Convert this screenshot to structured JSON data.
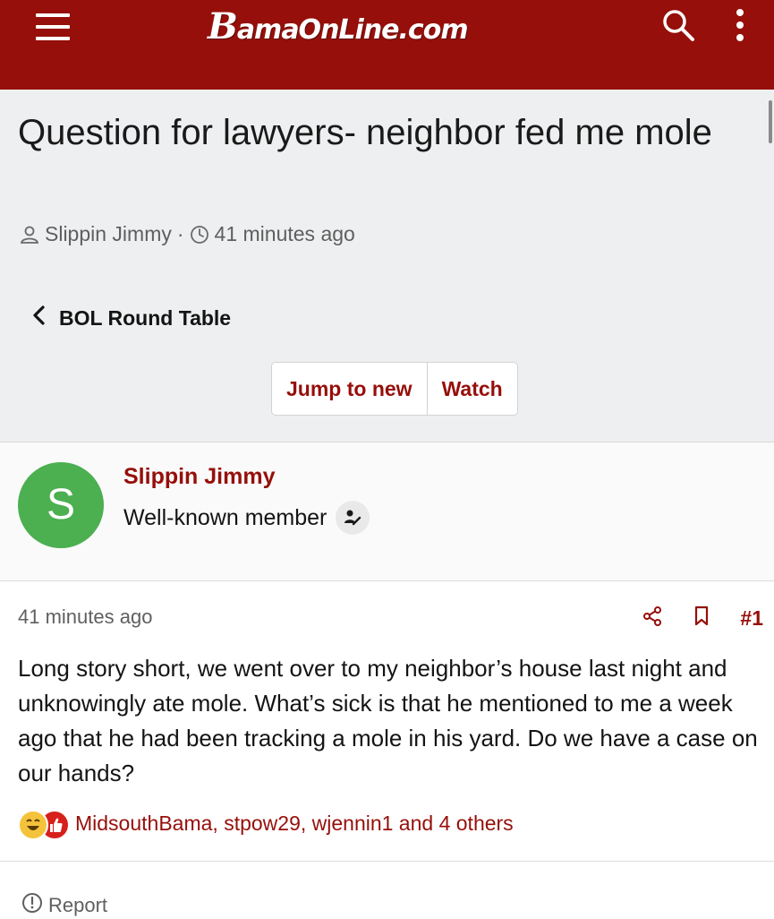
{
  "header": {
    "logo_first": "B",
    "logo_rest": "amaOnLine.com",
    "menu_icon": "hamburger-menu-icon",
    "search_icon": "search-icon",
    "more_icon": "vertical-ellipsis-icon",
    "bar_color": "#960f0a"
  },
  "thread": {
    "title": "Question for lawyers- neighbor fed me mole",
    "author": "Slippin Jimmy",
    "separator": "·",
    "time": "41 minutes ago"
  },
  "breadcrumb": {
    "label": "BOL Round Table"
  },
  "buttons": {
    "jump_to_new": "Jump to new",
    "watch": "Watch"
  },
  "user": {
    "avatar_letter": "S",
    "avatar_color": "#4caf50",
    "name": "Slippin Jimmy",
    "title": "Well-known member"
  },
  "post": {
    "time": "41 minutes ago",
    "number": "#1",
    "body": "Long story short, we went over to my neighbor’s house last night and unknowingly ate mole. What’s sick is that he mentioned to me a week ago that he had been tracking a mole in his yard. Do we have a case on our hands?",
    "reactions_text": "MidsouthBama, stpow29, wjennin1 and 4 others",
    "report_label": "Report"
  },
  "colors": {
    "accent": "#960f0a",
    "muted": "#5f5f5f",
    "background_gray": "#eeeff0"
  }
}
